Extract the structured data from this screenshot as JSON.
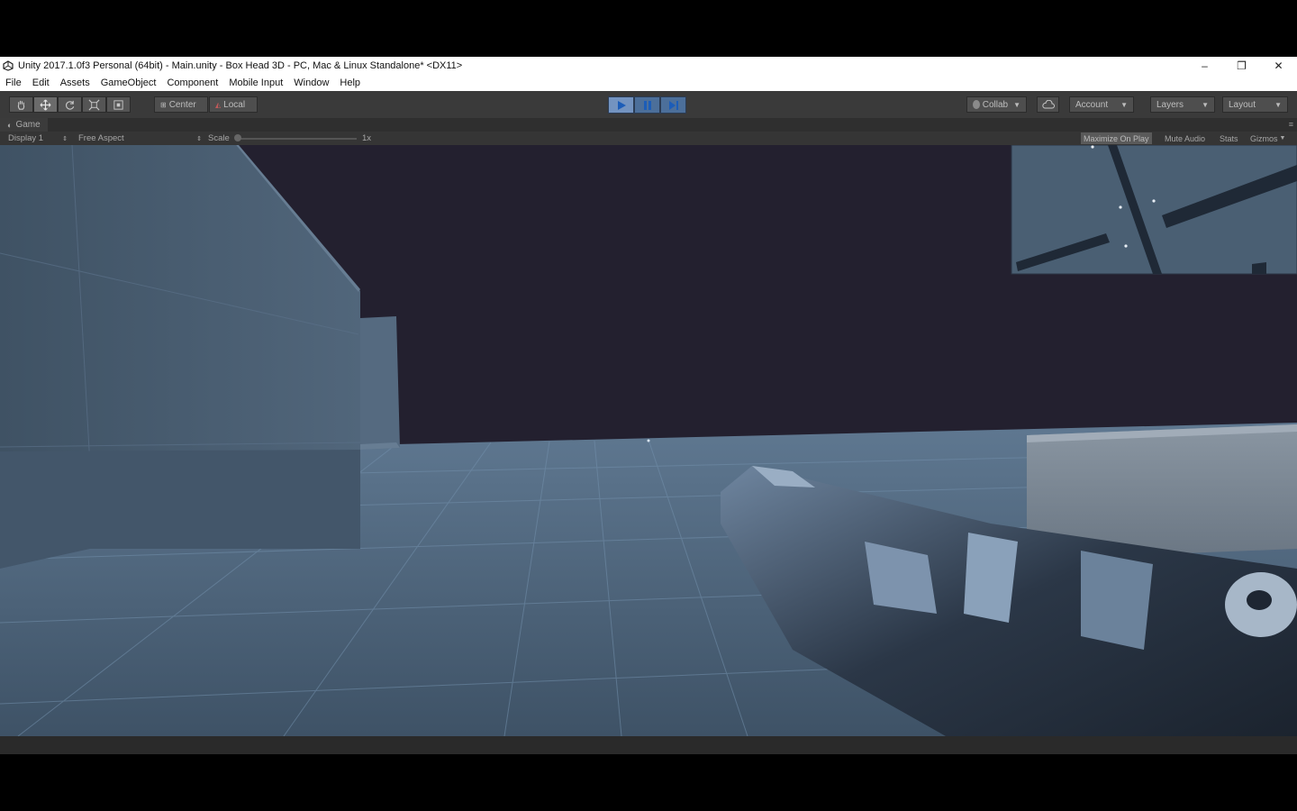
{
  "window": {
    "title": "Unity 2017.1.0f3 Personal (64bit) - Main.unity - Box Head 3D - PC, Mac & Linux Standalone* <DX11>",
    "controls": {
      "minimize": "–",
      "restore": "❐",
      "close": "✕"
    }
  },
  "menu": [
    "File",
    "Edit",
    "Assets",
    "GameObject",
    "Component",
    "Mobile Input",
    "Window",
    "Help"
  ],
  "toolbar": {
    "tools": [
      "hand-icon",
      "move-icon",
      "rotate-icon",
      "scale-icon",
      "rect-icon"
    ],
    "pivot_label": "Center",
    "space_label": "Local",
    "collab_label": "Collab",
    "account_label": "Account",
    "layers_label": "Layers",
    "layout_label": "Layout",
    "play_state": "playing"
  },
  "game_tab": {
    "label": "Game",
    "display": "Display 1",
    "aspect": "Free Aspect",
    "scale_label": "Scale",
    "scale_value": "1x",
    "maximize_on_play": "Maximize On Play",
    "mute_audio": "Mute Audio",
    "stats": "Stats",
    "gizmos": "Gizmos"
  },
  "colors": {
    "accent_play": "#7393c0",
    "sky": "#23202f",
    "floor": "#4d6378",
    "wall": "#4a5d70"
  }
}
